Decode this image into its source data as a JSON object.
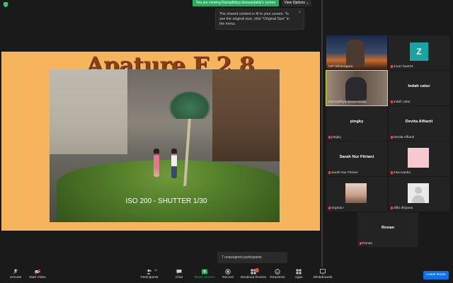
{
  "top": {
    "banner": "You are viewing Ramadhitya dessandaldy's screen",
    "view_options": "View Options ⌄"
  },
  "tooltip": {
    "text": "The shared content is fit to your screen. To see the original size, click \"Original Size\" in the menu.",
    "close": "×"
  },
  "slide": {
    "title": "Apature F 2,8",
    "caption": "ISO 200 - SHUTTER 1/30"
  },
  "gallery": [
    {
      "name": "IGP Wiranegara",
      "kind": "sunset"
    },
    {
      "name": "zoom baaO4",
      "kind": "avatar",
      "letter": "Z"
    },
    {
      "name": "Ramadhitya dessandaldy",
      "kind": "room",
      "active": true
    },
    {
      "name": "indah catur",
      "kind": "name",
      "label": "Indah catur"
    },
    {
      "name": "pingky",
      "kind": "name",
      "label": "pingky"
    },
    {
      "name": "Devita Alfianti",
      "kind": "name",
      "label": "Devita Alfianti"
    },
    {
      "name": "Sarah Nur Fitriani",
      "kind": "name",
      "label": "Sarah Nur Fitriani"
    },
    {
      "name": "inka ivanka",
      "kind": "pink"
    },
    {
      "name": "virginia r",
      "kind": "photo"
    },
    {
      "name": "diffa dhiyana",
      "kind": "generic"
    },
    {
      "name": "Ronan",
      "kind": "name",
      "label": "Ronan"
    }
  ],
  "unassigned": "7 unassigned participants",
  "toolbar": {
    "unmute": "Unmute",
    "start_video": "Start Video",
    "participants": "Participants",
    "participants_count": "11",
    "chat": "Chat",
    "share_screen": "Share Screen",
    "record": "Record",
    "breakout_rooms": "Breakout Rooms",
    "reactions": "Reactions",
    "apps": "Apps",
    "whiteboards": "Whiteboards",
    "leave": "Leave Room"
  },
  "colors": {
    "accent_green": "#27ae60",
    "leave_blue": "#0e72ed",
    "slide_bg": "#f6b45c",
    "title": "#8a3d1a",
    "muted_red": "#e74c3c"
  }
}
